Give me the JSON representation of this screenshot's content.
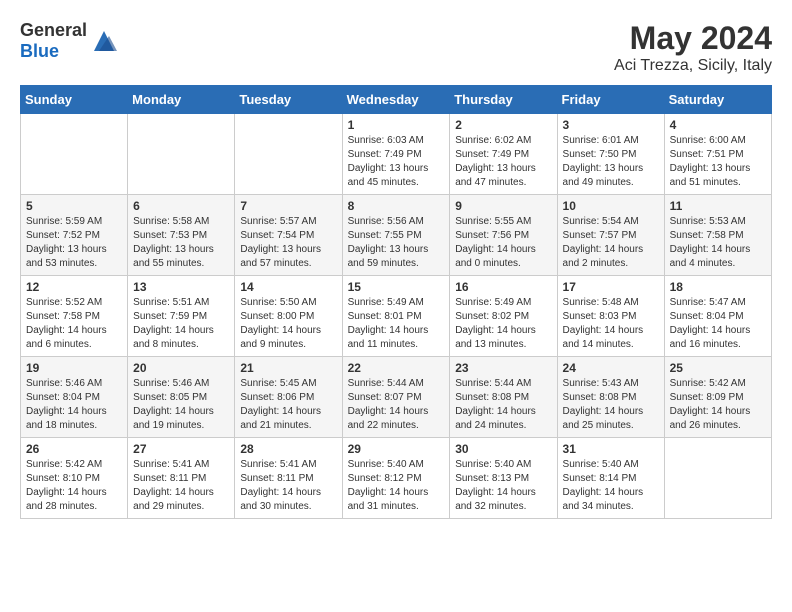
{
  "header": {
    "logo_general": "General",
    "logo_blue": "Blue",
    "month_year": "May 2024",
    "location": "Aci Trezza, Sicily, Italy"
  },
  "weekdays": [
    "Sunday",
    "Monday",
    "Tuesday",
    "Wednesday",
    "Thursday",
    "Friday",
    "Saturday"
  ],
  "weeks": [
    [
      {
        "day": "",
        "info": ""
      },
      {
        "day": "",
        "info": ""
      },
      {
        "day": "",
        "info": ""
      },
      {
        "day": "1",
        "info": "Sunrise: 6:03 AM\nSunset: 7:49 PM\nDaylight: 13 hours\nand 45 minutes."
      },
      {
        "day": "2",
        "info": "Sunrise: 6:02 AM\nSunset: 7:49 PM\nDaylight: 13 hours\nand 47 minutes."
      },
      {
        "day": "3",
        "info": "Sunrise: 6:01 AM\nSunset: 7:50 PM\nDaylight: 13 hours\nand 49 minutes."
      },
      {
        "day": "4",
        "info": "Sunrise: 6:00 AM\nSunset: 7:51 PM\nDaylight: 13 hours\nand 51 minutes."
      }
    ],
    [
      {
        "day": "5",
        "info": "Sunrise: 5:59 AM\nSunset: 7:52 PM\nDaylight: 13 hours\nand 53 minutes."
      },
      {
        "day": "6",
        "info": "Sunrise: 5:58 AM\nSunset: 7:53 PM\nDaylight: 13 hours\nand 55 minutes."
      },
      {
        "day": "7",
        "info": "Sunrise: 5:57 AM\nSunset: 7:54 PM\nDaylight: 13 hours\nand 57 minutes."
      },
      {
        "day": "8",
        "info": "Sunrise: 5:56 AM\nSunset: 7:55 PM\nDaylight: 13 hours\nand 59 minutes."
      },
      {
        "day": "9",
        "info": "Sunrise: 5:55 AM\nSunset: 7:56 PM\nDaylight: 14 hours\nand 0 minutes."
      },
      {
        "day": "10",
        "info": "Sunrise: 5:54 AM\nSunset: 7:57 PM\nDaylight: 14 hours\nand 2 minutes."
      },
      {
        "day": "11",
        "info": "Sunrise: 5:53 AM\nSunset: 7:58 PM\nDaylight: 14 hours\nand 4 minutes."
      }
    ],
    [
      {
        "day": "12",
        "info": "Sunrise: 5:52 AM\nSunset: 7:58 PM\nDaylight: 14 hours\nand 6 minutes."
      },
      {
        "day": "13",
        "info": "Sunrise: 5:51 AM\nSunset: 7:59 PM\nDaylight: 14 hours\nand 8 minutes."
      },
      {
        "day": "14",
        "info": "Sunrise: 5:50 AM\nSunset: 8:00 PM\nDaylight: 14 hours\nand 9 minutes."
      },
      {
        "day": "15",
        "info": "Sunrise: 5:49 AM\nSunset: 8:01 PM\nDaylight: 14 hours\nand 11 minutes."
      },
      {
        "day": "16",
        "info": "Sunrise: 5:49 AM\nSunset: 8:02 PM\nDaylight: 14 hours\nand 13 minutes."
      },
      {
        "day": "17",
        "info": "Sunrise: 5:48 AM\nSunset: 8:03 PM\nDaylight: 14 hours\nand 14 minutes."
      },
      {
        "day": "18",
        "info": "Sunrise: 5:47 AM\nSunset: 8:04 PM\nDaylight: 14 hours\nand 16 minutes."
      }
    ],
    [
      {
        "day": "19",
        "info": "Sunrise: 5:46 AM\nSunset: 8:04 PM\nDaylight: 14 hours\nand 18 minutes."
      },
      {
        "day": "20",
        "info": "Sunrise: 5:46 AM\nSunset: 8:05 PM\nDaylight: 14 hours\nand 19 minutes."
      },
      {
        "day": "21",
        "info": "Sunrise: 5:45 AM\nSunset: 8:06 PM\nDaylight: 14 hours\nand 21 minutes."
      },
      {
        "day": "22",
        "info": "Sunrise: 5:44 AM\nSunset: 8:07 PM\nDaylight: 14 hours\nand 22 minutes."
      },
      {
        "day": "23",
        "info": "Sunrise: 5:44 AM\nSunset: 8:08 PM\nDaylight: 14 hours\nand 24 minutes."
      },
      {
        "day": "24",
        "info": "Sunrise: 5:43 AM\nSunset: 8:08 PM\nDaylight: 14 hours\nand 25 minutes."
      },
      {
        "day": "25",
        "info": "Sunrise: 5:42 AM\nSunset: 8:09 PM\nDaylight: 14 hours\nand 26 minutes."
      }
    ],
    [
      {
        "day": "26",
        "info": "Sunrise: 5:42 AM\nSunset: 8:10 PM\nDaylight: 14 hours\nand 28 minutes."
      },
      {
        "day": "27",
        "info": "Sunrise: 5:41 AM\nSunset: 8:11 PM\nDaylight: 14 hours\nand 29 minutes."
      },
      {
        "day": "28",
        "info": "Sunrise: 5:41 AM\nSunset: 8:11 PM\nDaylight: 14 hours\nand 30 minutes."
      },
      {
        "day": "29",
        "info": "Sunrise: 5:40 AM\nSunset: 8:12 PM\nDaylight: 14 hours\nand 31 minutes."
      },
      {
        "day": "30",
        "info": "Sunrise: 5:40 AM\nSunset: 8:13 PM\nDaylight: 14 hours\nand 32 minutes."
      },
      {
        "day": "31",
        "info": "Sunrise: 5:40 AM\nSunset: 8:14 PM\nDaylight: 14 hours\nand 34 minutes."
      },
      {
        "day": "",
        "info": ""
      }
    ]
  ]
}
